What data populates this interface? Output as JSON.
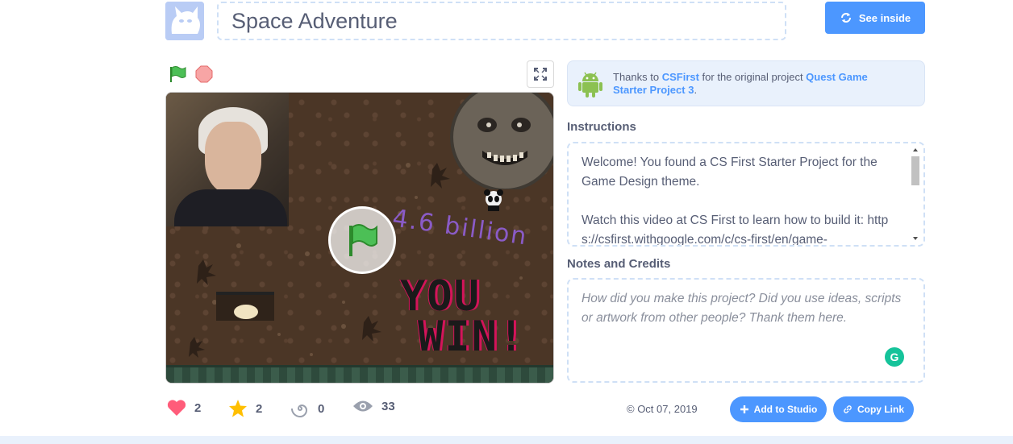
{
  "project": {
    "title": "Space Adventure",
    "see_inside_label": "See inside"
  },
  "remix": {
    "prefix": "Thanks to ",
    "author": "CSFirst",
    "middle": " for the original project ",
    "original_project": "Quest Game Starter Project 3",
    "suffix": "."
  },
  "instructions": {
    "heading": "Instructions",
    "text_p1": "Welcome! You found a CS First Starter Project for the Game Design theme.",
    "text_p2": "Watch this video at CS First to learn how to build it: https://csfirst.withgoogle.com/c/cs-first/en/game-"
  },
  "notes": {
    "heading": "Notes and Credits",
    "placeholder": "How did you make this project? Did you use ideas, scripts or artwork from other people? Thank them here."
  },
  "stage": {
    "scribble_text": "4.6 billion",
    "you_win_line1": "YOU",
    "you_win_line2": "WIN!"
  },
  "stats": {
    "loves": "2",
    "favorites": "2",
    "remixes": "0",
    "views": "33"
  },
  "footer": {
    "date": "© Oct 07, 2019",
    "add_to_studio": "Add to Studio",
    "copy_link": "Copy Link"
  },
  "colors": {
    "accent": "#4c97ff",
    "text": "#575e75",
    "love": "#ff5c7a",
    "favorite": "#ffbf00"
  }
}
